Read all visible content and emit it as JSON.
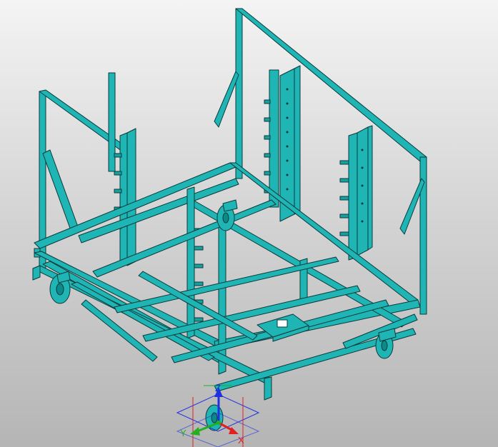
{
  "viewport": {
    "model_color": "#1fb5b5",
    "edge_color": "#0a3a3a",
    "background_top": "#f4f4f4",
    "background_bottom": "#b5b5b5"
  },
  "model": {
    "parts": [
      "frame",
      "uprights",
      "ladder-posts",
      "cross-members",
      "casters",
      "base-plate"
    ]
  },
  "triad": {
    "x_label": "X",
    "y_label": "Y",
    "z_label": "Z",
    "x_color": "#e02020",
    "y_color": "#20b020",
    "z_color": "#2030e0"
  }
}
